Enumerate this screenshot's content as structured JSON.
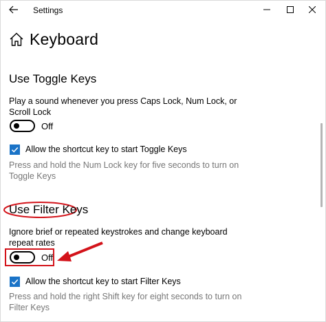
{
  "window": {
    "app_title": "Settings"
  },
  "page": {
    "title": "Keyboard"
  },
  "toggle_keys": {
    "heading": "Use Toggle Keys",
    "description": "Play a sound whenever you press Caps Lock, Num Lock, or Scroll Lock",
    "toggle_state": "Off",
    "shortcut_label": "Allow the shortcut key to start Toggle Keys",
    "shortcut_checked": true,
    "help_text": "Press and hold the Num Lock key for five seconds to turn on Toggle Keys"
  },
  "filter_keys": {
    "heading": "Use Filter Keys",
    "description": "Ignore brief or repeated keystrokes and change keyboard repeat rates",
    "toggle_state": "Off",
    "shortcut_label": "Allow the shortcut key to start Filter Keys",
    "shortcut_checked": true,
    "help_text": "Press and hold the right Shift key for eight seconds to turn on Filter Keys"
  },
  "colors": {
    "accent": "#1a73c7",
    "annotation": "#d3131a",
    "help_text": "#767676"
  },
  "icons": [
    "back-arrow-icon",
    "minimize-icon",
    "maximize-icon",
    "close-icon",
    "home-icon",
    "checkmark-icon"
  ]
}
